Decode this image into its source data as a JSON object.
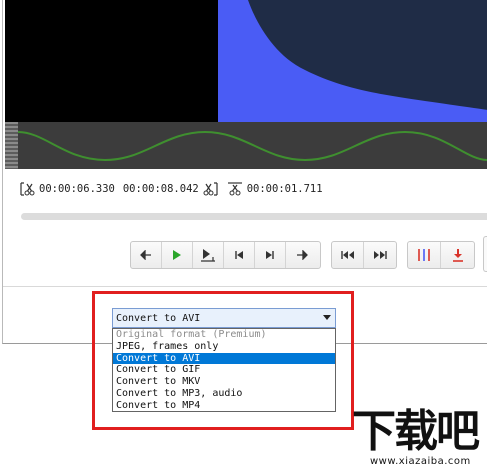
{
  "window": {
    "timeline": {
      "start_time": "00:00:06.330",
      "end_time": "00:00:08.042",
      "duration": "00:00:01.711",
      "playback_progress": 0.0
    },
    "transport": {
      "buttons": [
        {
          "name": "step-back-button",
          "icon": "arrow-left-icon"
        },
        {
          "name": "play-button",
          "icon": "play-icon"
        },
        {
          "name": "play-selection-button",
          "icon": "play-to-mark-icon"
        },
        {
          "name": "prev-frame-button",
          "icon": "skip-back-icon"
        },
        {
          "name": "next-frame-button",
          "icon": "skip-forward-icon"
        },
        {
          "name": "step-forward-button",
          "icon": "arrow-right-icon"
        }
      ],
      "jump_buttons": [
        "jump-start-button",
        "jump-end-button"
      ],
      "marker_buttons": [
        "cut-markers-button",
        "save-button"
      ]
    },
    "colors": {
      "accent_blue": "#4a5cf5",
      "wave_green": "#3f8f2f",
      "play_green": "#2aa52a",
      "marker_red": "#d9342b",
      "highlight_red": "#e11f1f",
      "selection_blue": "#0078d7"
    }
  },
  "format": {
    "selected": "Convert to AVI",
    "options": [
      {
        "label": "Original format (Premium)",
        "state": "disabled"
      },
      {
        "label": "JPEG, frames only",
        "state": "normal"
      },
      {
        "label": "Convert to AVI",
        "state": "selected"
      },
      {
        "label": "Convert to GIF",
        "state": "normal"
      },
      {
        "label": "Convert to MKV",
        "state": "normal"
      },
      {
        "label": "Convert to MP3, audio",
        "state": "normal"
      },
      {
        "label": "Convert to MP4",
        "state": "normal"
      }
    ]
  },
  "watermark": {
    "mark": "下载吧",
    "url": "www.xiazaiba.com"
  }
}
